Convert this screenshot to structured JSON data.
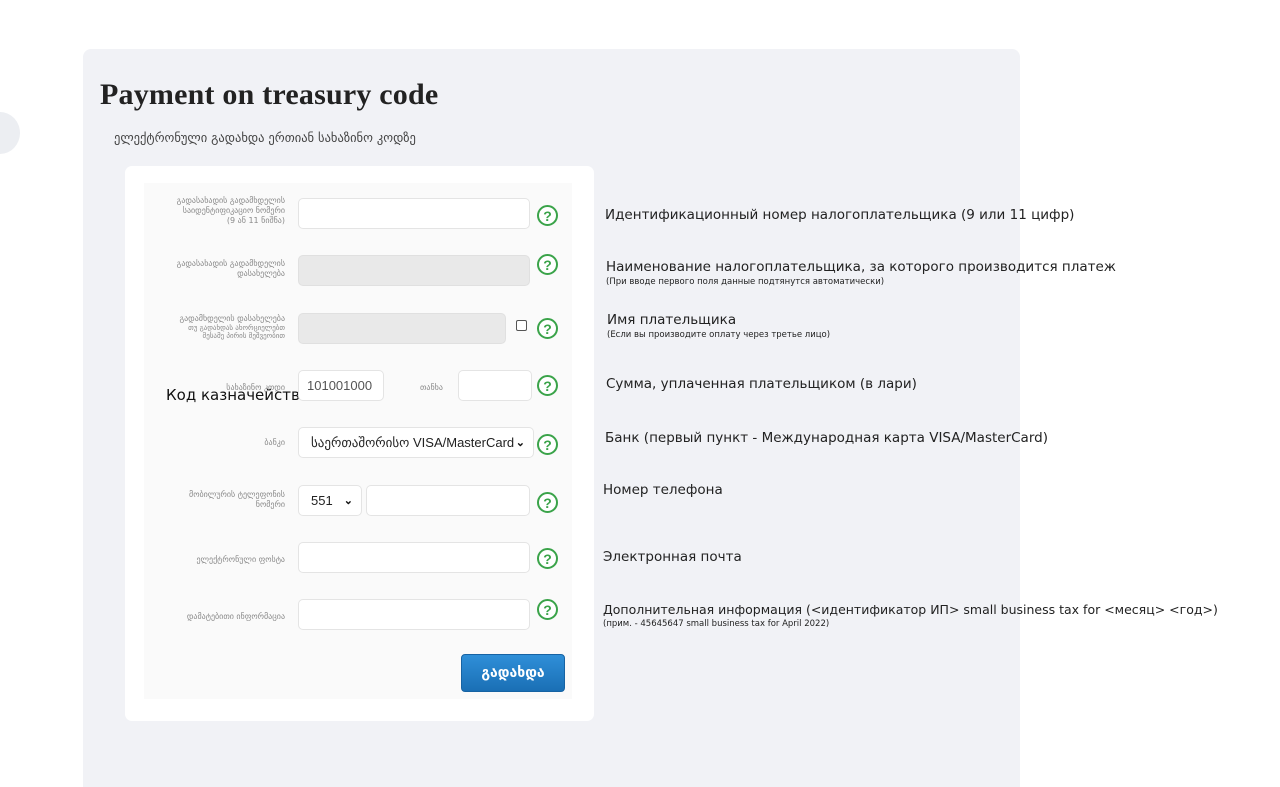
{
  "page": {
    "title": "Payment on treasury code",
    "subtitle": "ელექტრონული გადახდა ერთიან სახაზინო კოდზე"
  },
  "form": {
    "help_glyph": "?",
    "fields": [
      {
        "label_lines": [
          "გადასახადის გადამხდელის",
          "საიდენტიფიკაციო ნომერი",
          "(9 ან 11 ნიშნა)"
        ],
        "value": "",
        "disabled": false
      },
      {
        "label_lines": [
          "გადასახადის გადამხდელის",
          "დასახელება"
        ],
        "value": "",
        "disabled": true
      },
      {
        "label_lines": [
          "გადამხდელის დასახელება",
          "თუ გადახდას ახორციელებთ",
          "მესამე პირის მეშვეობით"
        ],
        "value": "",
        "disabled": true,
        "checkbox_checked": false
      },
      {
        "label_lines": [
          "სახაზინო კოდი"
        ],
        "value": "101001000",
        "amount_label": "თანხა",
        "amount_value": ""
      },
      {
        "label_lines": [
          "ბანკი"
        ],
        "value": "საერთაშორისო VISA/MasterCard"
      },
      {
        "label_lines": [
          "მობილურის ტელეფონის",
          "ნომერი"
        ],
        "prefix": "551",
        "value": ""
      },
      {
        "label_lines": [
          "ელექტრონული ფოსტა"
        ],
        "value": ""
      },
      {
        "label_lines": [
          "დამატებითი ინფორმაცია"
        ],
        "value": ""
      }
    ],
    "treasury_code_overlay": "Код казначейства",
    "submit_label": "გადახდა"
  },
  "annotations": [
    {
      "text": "Идентификационный номер налогоплательщика (9 или 11 цифр)",
      "note": ""
    },
    {
      "text": "Наименование налогоплательщика, за которого производится платеж",
      "note": "(При вводе первого поля данные подтянутся автоматически)"
    },
    {
      "text": "Имя плательщика",
      "note": "(Если вы производите оплату через третье лицо)"
    },
    {
      "text": "Сумма, уплаченная плательщиком (в лари)",
      "note": ""
    },
    {
      "text": "Банк (первый пункт - Международная карта VISA/MasterCard)",
      "note": ""
    },
    {
      "text": "Номер телефона",
      "note": ""
    },
    {
      "text": "Электронная почта",
      "note": ""
    },
    {
      "text": "Дополнительная информация (<идентификатор ИП> small business tax for <месяц> <год>)",
      "note": "(прим. - 45645647 small business tax for April 2022)"
    }
  ],
  "colors": {
    "panel_bg": "#f1f2f6",
    "help_green": "#3aa349",
    "button_blue": "#1f7cc4"
  }
}
